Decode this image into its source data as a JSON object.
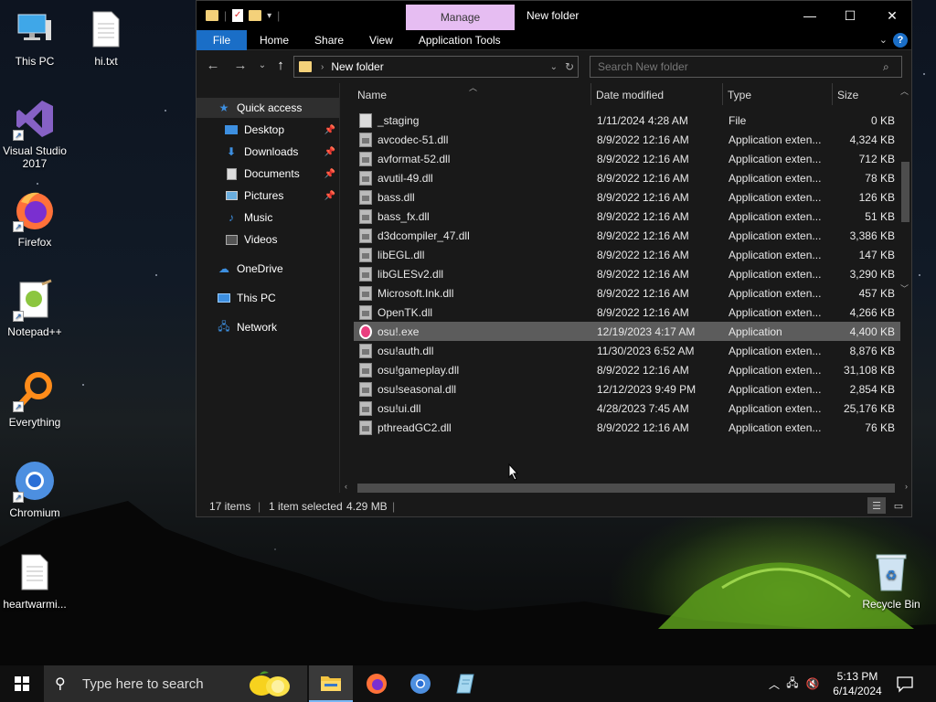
{
  "desktop": {
    "icons": [
      {
        "label": "This PC"
      },
      {
        "label": "hi.txt"
      },
      {
        "label": "Visual Studio 2017"
      },
      {
        "label": "Firefox"
      },
      {
        "label": "Notepad++"
      },
      {
        "label": "Everything"
      },
      {
        "label": "Chromium"
      },
      {
        "label": "heartwarmi..."
      },
      {
        "label": "Recycle Bin"
      }
    ]
  },
  "window": {
    "title": "New folder",
    "context_tab": "Manage",
    "ribbon_tabs": [
      "File",
      "Home",
      "Share",
      "View",
      "Application Tools"
    ],
    "address_path": "New folder",
    "search_placeholder": "Search New folder",
    "nav": {
      "quick_access": "Quick access",
      "items": [
        {
          "label": "Desktop",
          "pinned": true
        },
        {
          "label": "Downloads",
          "pinned": true
        },
        {
          "label": "Documents",
          "pinned": true
        },
        {
          "label": "Pictures",
          "pinned": true
        },
        {
          "label": "Music",
          "pinned": false
        },
        {
          "label": "Videos",
          "pinned": false
        }
      ],
      "onedrive": "OneDrive",
      "this_pc": "This PC",
      "network": "Network"
    },
    "columns": [
      "Name",
      "Date modified",
      "Type",
      "Size"
    ],
    "files": [
      {
        "name": "_staging",
        "date": "1/11/2024 4:28 AM",
        "type": "File",
        "size": "0 KB",
        "icon": "file"
      },
      {
        "name": "avcodec-51.dll",
        "date": "8/9/2022 12:16 AM",
        "type": "Application exten...",
        "size": "4,324 KB",
        "icon": "dll"
      },
      {
        "name": "avformat-52.dll",
        "date": "8/9/2022 12:16 AM",
        "type": "Application exten...",
        "size": "712 KB",
        "icon": "dll"
      },
      {
        "name": "avutil-49.dll",
        "date": "8/9/2022 12:16 AM",
        "type": "Application exten...",
        "size": "78 KB",
        "icon": "dll"
      },
      {
        "name": "bass.dll",
        "date": "8/9/2022 12:16 AM",
        "type": "Application exten...",
        "size": "126 KB",
        "icon": "dll"
      },
      {
        "name": "bass_fx.dll",
        "date": "8/9/2022 12:16 AM",
        "type": "Application exten...",
        "size": "51 KB",
        "icon": "dll"
      },
      {
        "name": "d3dcompiler_47.dll",
        "date": "8/9/2022 12:16 AM",
        "type": "Application exten...",
        "size": "3,386 KB",
        "icon": "dll"
      },
      {
        "name": "libEGL.dll",
        "date": "8/9/2022 12:16 AM",
        "type": "Application exten...",
        "size": "147 KB",
        "icon": "dll"
      },
      {
        "name": "libGLESv2.dll",
        "date": "8/9/2022 12:16 AM",
        "type": "Application exten...",
        "size": "3,290 KB",
        "icon": "dll"
      },
      {
        "name": "Microsoft.Ink.dll",
        "date": "8/9/2022 12:16 AM",
        "type": "Application exten...",
        "size": "457 KB",
        "icon": "dll"
      },
      {
        "name": "OpenTK.dll",
        "date": "8/9/2022 12:16 AM",
        "type": "Application exten...",
        "size": "4,266 KB",
        "icon": "dll"
      },
      {
        "name": "osu!.exe",
        "date": "12/19/2023 4:17 AM",
        "type": "Application",
        "size": "4,400 KB",
        "icon": "osu",
        "selected": true
      },
      {
        "name": "osu!auth.dll",
        "date": "11/30/2023 6:52 AM",
        "type": "Application exten...",
        "size": "8,876 KB",
        "icon": "dll"
      },
      {
        "name": "osu!gameplay.dll",
        "date": "8/9/2022 12:16 AM",
        "type": "Application exten...",
        "size": "31,108 KB",
        "icon": "dll"
      },
      {
        "name": "osu!seasonal.dll",
        "date": "12/12/2023 9:49 PM",
        "type": "Application exten...",
        "size": "2,854 KB",
        "icon": "dll"
      },
      {
        "name": "osu!ui.dll",
        "date": "4/28/2023 7:45 AM",
        "type": "Application exten...",
        "size": "25,176 KB",
        "icon": "dll"
      },
      {
        "name": "pthreadGC2.dll",
        "date": "8/9/2022 12:16 AM",
        "type": "Application exten...",
        "size": "76 KB",
        "icon": "dll"
      }
    ],
    "status": {
      "items": "17 items",
      "selected": "1 item selected",
      "size": "4.29 MB"
    }
  },
  "taskbar": {
    "search_placeholder": "Type here to search",
    "time": "5:13 PM",
    "date": "6/14/2024"
  },
  "colors": {
    "accent": "#1a6ec7",
    "manage_tab": "#e6bdf2",
    "selected_row": "#5c5c5c"
  }
}
